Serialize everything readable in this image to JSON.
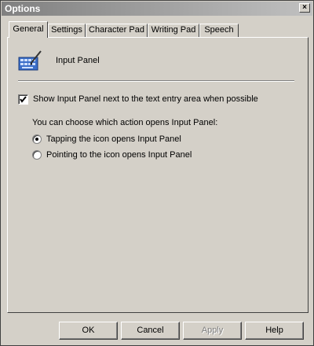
{
  "window": {
    "title": "Options",
    "close_label": "×"
  },
  "tabs": [
    {
      "label": "General",
      "active": true
    },
    {
      "label": "Settings",
      "active": false
    },
    {
      "label": "Character Pad",
      "active": false
    },
    {
      "label": "Writing Pad",
      "active": false
    },
    {
      "label": "Speech",
      "active": false
    }
  ],
  "general": {
    "header_icon": "input-panel-icon",
    "header_label": "Input Panel",
    "show_panel": {
      "checked": true,
      "label": "Show Input Panel next to the text entry area when possible"
    },
    "action_prompt": "You can choose which action opens Input Panel:",
    "options": [
      {
        "label": "Tapping the icon opens Input Panel",
        "selected": true
      },
      {
        "label": "Pointing to the icon opens Input Panel",
        "selected": false
      }
    ]
  },
  "buttons": {
    "ok": "OK",
    "cancel": "Cancel",
    "apply": "Apply",
    "help": "Help"
  }
}
